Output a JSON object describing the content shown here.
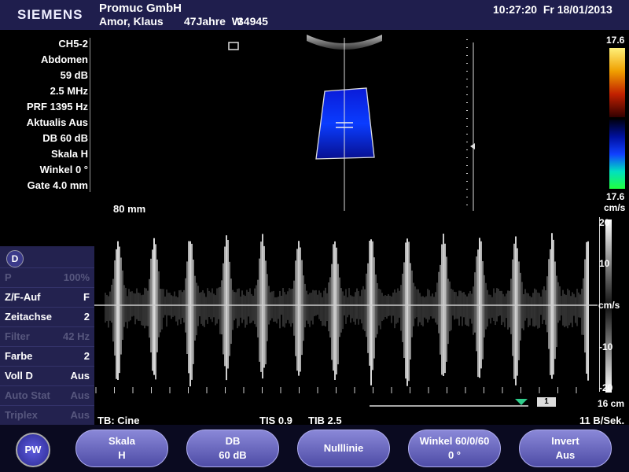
{
  "header": {
    "logo": "SIEMENS",
    "clinic": "Promuc GmbH",
    "patient_name": "Amor, Klaus",
    "patient_age": "47Jahre",
    "patient_sex": "W",
    "patient_id": "34945",
    "time": "10:27:20",
    "date": "Fr  18/01/2013"
  },
  "params": [
    "CH5-2",
    "Abdomen",
    "59 dB",
    "2.5 MHz",
    "PRF 1395 Hz",
    "Aktualis Aus",
    "DB 60 dB",
    "Skala H",
    "Winkel 0 °",
    "Gate 4.0 mm"
  ],
  "depth_label": "80 mm",
  "color_scale": {
    "top": "17.6",
    "bottom": "17.6",
    "unit": "cm/s"
  },
  "velocity_scale": {
    "ticks": [
      "20",
      "10",
      "cm/s",
      "-10",
      "-20"
    ],
    "depth": "16 cm"
  },
  "menu": {
    "badge": "D",
    "items": [
      {
        "label": "P",
        "value": "100%",
        "disabled": true
      },
      {
        "label": "Z/F-Auf",
        "value": "F",
        "disabled": false
      },
      {
        "label": "Zeitachse",
        "value": "2",
        "disabled": false
      },
      {
        "label": "Filter",
        "value": "42 Hz",
        "disabled": true
      },
      {
        "label": "Farbe",
        "value": "2",
        "disabled": false
      },
      {
        "label": "Voll D",
        "value": "Aus",
        "disabled": false
      },
      {
        "label": "Auto Stat",
        "value": "Aus",
        "disabled": true
      },
      {
        "label": "Triplex",
        "value": "Aus",
        "disabled": true
      }
    ]
  },
  "status": {
    "cine": "TB: Cine",
    "tis": "TIS 0.9",
    "tib": "TIB 2.5",
    "frame_rate": "11 B/Sek.",
    "page": "1"
  },
  "buttons": {
    "pw": "PW",
    "skala": {
      "label": "Skala",
      "value": "H"
    },
    "db": {
      "label": "DB",
      "value": "60 dB"
    },
    "nulllinie": {
      "label": "Nulllinie"
    },
    "winkel": {
      "label": "Winkel 60/0/60",
      "value": "0 °"
    },
    "invert": {
      "label": "Invert",
      "value": "Aus"
    }
  },
  "colors": {
    "header_bg": "#1f1e4d",
    "button": "#6c6ac6",
    "menu_bg": "#23224f",
    "cursor": "#2ecc8a"
  }
}
